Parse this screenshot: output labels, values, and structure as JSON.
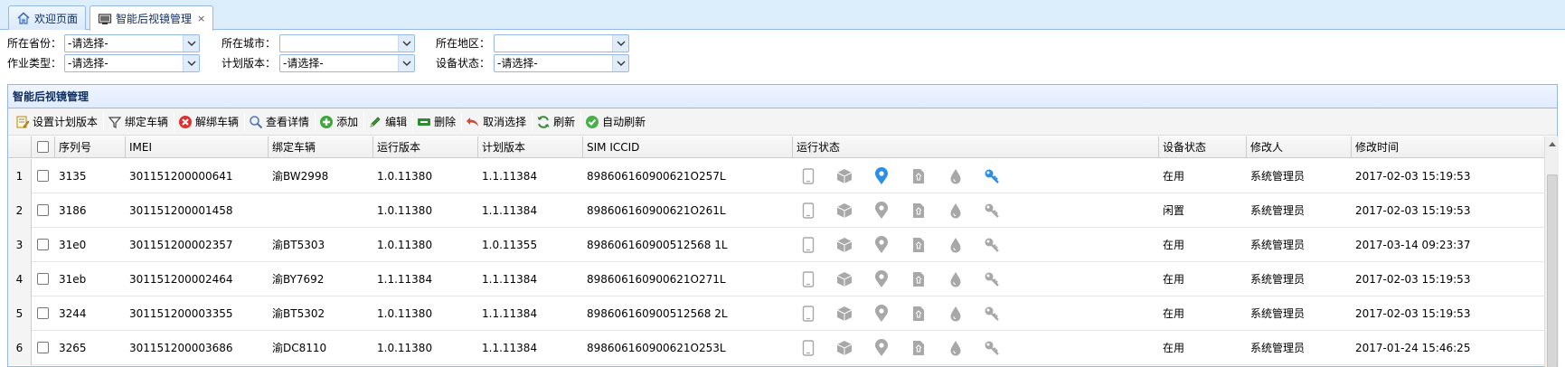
{
  "tabs": [
    {
      "label": "欢迎页面",
      "icon": "home-icon"
    },
    {
      "label": "智能后视镜管理",
      "icon": "monitor-icon",
      "close": "×"
    }
  ],
  "filters": {
    "province": {
      "label": "所在省份：",
      "value": "-请选择-"
    },
    "city": {
      "label": "所在城市：",
      "value": ""
    },
    "district": {
      "label": "所在地区：",
      "value": ""
    },
    "work_type": {
      "label": "作业类型：",
      "value": "-请选择-"
    },
    "plan_version": {
      "label": "计划版本：",
      "value": "-请选择-"
    },
    "device_status": {
      "label": "设备状态：",
      "value": "-请选择-"
    }
  },
  "panel": {
    "title": "智能后视镜管理"
  },
  "toolbar": [
    {
      "label": "设置计划版本",
      "icon": "edit-plan-icon"
    },
    {
      "label": "绑定车辆",
      "icon": "filter-icon"
    },
    {
      "label": "解绑车辆",
      "icon": "cancel-circle-icon"
    },
    {
      "label": "查看详情",
      "icon": "search-icon"
    },
    {
      "label": "添加",
      "icon": "add-icon"
    },
    {
      "label": "编辑",
      "icon": "pencil-icon"
    },
    {
      "label": "删除",
      "icon": "minus-icon"
    },
    {
      "label": "取消选择",
      "icon": "undo-icon"
    },
    {
      "label": "刷新",
      "icon": "reload-icon"
    },
    {
      "label": "自动刷新",
      "icon": "ok-icon"
    }
  ],
  "columns": [
    "序列号",
    "IMEI",
    "绑定车辆",
    "运行版本",
    "计划版本",
    "SIM ICCID",
    "运行状态",
    "设备状态",
    "修改人",
    "修改时间"
  ],
  "status_icon_names": [
    "phone-icon",
    "box-icon",
    "location-pin-icon",
    "document-icon",
    "drop-icon",
    "key-icon"
  ],
  "colors": {
    "active_icon": "#2b8fe6",
    "inactive_icon": "#a8a8a8",
    "accent": "#95b8e7"
  },
  "rows": [
    {
      "num": "1",
      "serial": "3135",
      "imei": "301151200000641",
      "vehicle": "渝BW2998",
      "run_version": "1.0.11380",
      "plan_version": "1.1.11384",
      "iccid": "898606160900621O257L",
      "status": "在用",
      "modifier": "系统管理员",
      "time": "2017-02-03 15:19:53",
      "active": true
    },
    {
      "num": "2",
      "serial": "3186",
      "imei": "301151200001458",
      "vehicle": "",
      "run_version": "1.0.11380",
      "plan_version": "1.1.11384",
      "iccid": "898606160900621O261L",
      "status": "闲置",
      "modifier": "系统管理员",
      "time": "2017-02-03 15:19:53",
      "active": false
    },
    {
      "num": "3",
      "serial": "31e0",
      "imei": "301151200002357",
      "vehicle": "渝BT5303",
      "run_version": "1.0.11380",
      "plan_version": "1.0.11355",
      "iccid": "898606160900512568 1L",
      "status": "在用",
      "modifier": "系统管理员",
      "time": "2017-03-14 09:23:37",
      "active": false
    },
    {
      "num": "4",
      "serial": "31eb",
      "imei": "301151200002464",
      "vehicle": "渝BY7692",
      "run_version": "1.1.11384",
      "plan_version": "1.1.11384",
      "iccid": "898606160900621O271L",
      "status": "在用",
      "modifier": "系统管理员",
      "time": "2017-02-03 15:19:53",
      "active": false
    },
    {
      "num": "5",
      "serial": "3244",
      "imei": "301151200003355",
      "vehicle": "渝BT5302",
      "run_version": "1.0.11380",
      "plan_version": "1.1.11384",
      "iccid": "898606160900512568 2L",
      "status": "在用",
      "modifier": "系统管理员",
      "time": "2017-02-03 15:19:53",
      "active": false
    },
    {
      "num": "6",
      "serial": "3265",
      "imei": "301151200003686",
      "vehicle": "渝DC8110",
      "run_version": "1.0.11380",
      "plan_version": "1.1.11384",
      "iccid": "898606160900621O253L",
      "status": "在用",
      "modifier": "系统管理员",
      "time": "2017-01-24 15:46:25",
      "active": false
    }
  ]
}
